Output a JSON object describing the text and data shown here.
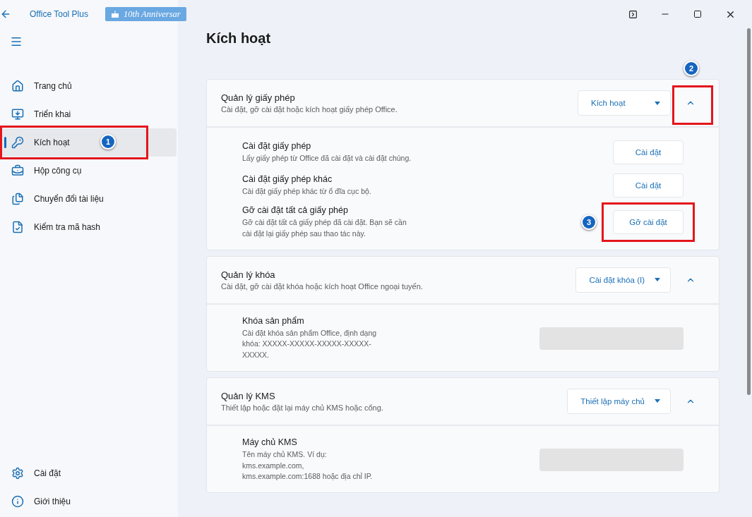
{
  "window": {
    "title": "Office Tool Plus",
    "badge": "10th Anniversar"
  },
  "sidebar": {
    "items": [
      {
        "label": "Trang chủ",
        "selected": false
      },
      {
        "label": "Triển khai",
        "selected": false
      },
      {
        "label": "Kích hoạt",
        "selected": true,
        "callout": "1"
      },
      {
        "label": "Hộp công cụ",
        "selected": false
      },
      {
        "label": "Chuyển đổi tài liệu",
        "selected": false
      },
      {
        "label": "Kiểm tra mã hash",
        "selected": false
      }
    ],
    "footer_items": [
      {
        "label": "Cài đặt",
        "selected": false
      },
      {
        "label": "Giới thiệu",
        "selected": false
      }
    ]
  },
  "page_title": "Kích hoạt",
  "sections": [
    {
      "title": "Quản lý giấy phép",
      "description": "Cài đặt, gỡ cài đặt hoặc kích hoạt giấy phép Office.",
      "dropdown": "Kích hoạt",
      "expanded": true,
      "toggle_callout": "2",
      "rows": [
        {
          "kind": "button",
          "title": "Cài đặt giấy phép",
          "description": "Lấy giấy phép từ Office đã cài đặt và cài đặt chúng.",
          "button": "Cài đặt"
        },
        {
          "kind": "button",
          "title": "Cài đặt giấy phép khác",
          "description": "Cài đặt giấy phép khác từ ổ đĩa cục bộ.",
          "button": "Cài đặt"
        },
        {
          "kind": "button",
          "title": "Gỡ cài đặt tất cả giấy phép",
          "description": "Gỡ cài đặt tất cả giấy phép đã cài đặt. Bạn sẽ cần cài đặt lại giấy phép sau thao tác này.",
          "button": "Gỡ cài đặt",
          "callout": "3"
        }
      ]
    },
    {
      "title": "Quản lý khóa",
      "description": "Cài đặt, gỡ cài đặt khóa hoặc kích hoạt Office ngoại tuyến.",
      "dropdown": "Cài đặt khóa (I)",
      "expanded": true,
      "rows": [
        {
          "kind": "input",
          "title": "Khóa sản phẩm",
          "description": "Cài đặt khóa sản phẩm Office, định dạng khóa: XXXXX-XXXXX-XXXXX-XXXXX-XXXXX."
        }
      ]
    },
    {
      "title": "Quản lý KMS",
      "description": "Thiết lập hoặc đặt lại máy chủ KMS hoặc cổng.",
      "dropdown": "Thiết lập máy chủ",
      "expanded": true,
      "rows": [
        {
          "kind": "input",
          "title": "Máy chủ KMS",
          "description": "Tên máy chủ KMS. Ví dụ: kms.example.com, kms.example.com:1688 hoặc địa chỉ IP."
        }
      ]
    }
  ]
}
